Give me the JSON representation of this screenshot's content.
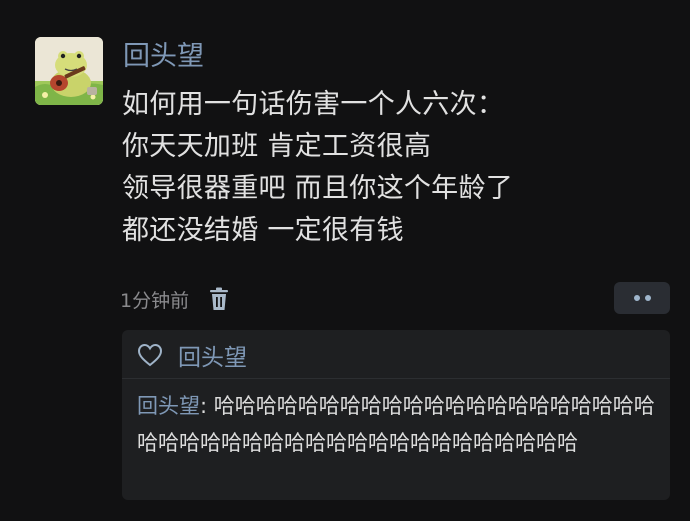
{
  "post": {
    "username": "回头望",
    "lines": [
      "如何用一句话伤害一个人六次：",
      "你天天加班 肯定工资很高",
      "领导很器重吧 而且你这个年龄了",
      "都还没结婚 一定很有钱"
    ],
    "timestamp": "1分钟前",
    "icons": {
      "avatar": "frog-with-guitar-avatar",
      "delete": "trash-icon",
      "more": "more-dots-icon"
    }
  },
  "reply_box": {
    "liked_by": "回头望",
    "like_icon": "heart-outline-icon",
    "reply": {
      "author": "回头望",
      "separator": ": ",
      "text": "哈哈哈哈哈哈哈哈哈哈哈哈哈哈哈哈哈哈哈哈哈哈哈哈哈哈哈哈哈哈哈哈哈哈哈哈哈哈哈哈哈哈"
    }
  },
  "colors": {
    "background": "#111112",
    "username": "#7f98b6",
    "body_text": "#e1e1e1",
    "meta_text": "#8a8a8d",
    "panel": "#1e1f21",
    "more_button": "#2a2d33"
  }
}
